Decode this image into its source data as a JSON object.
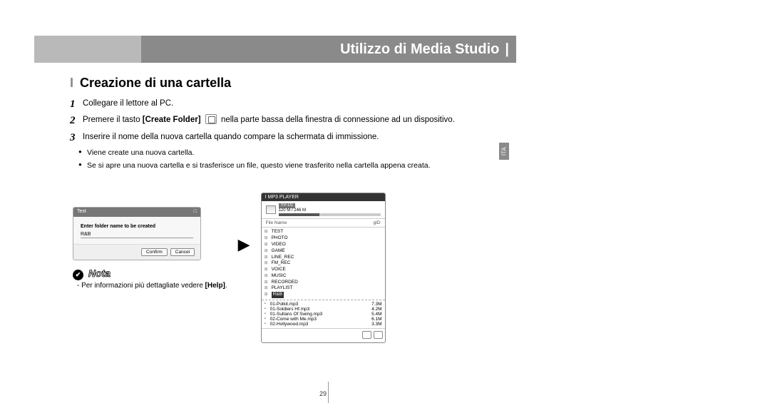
{
  "header": {
    "title": "Utilizzo di Media Studio"
  },
  "section": {
    "heading": "Creazione di una cartella",
    "bar": "I"
  },
  "steps": {
    "s1": {
      "num": "1",
      "text": "Collegare il lettore al PC."
    },
    "s2": {
      "num": "2",
      "pre": "Premere il tasto ",
      "bold": "[Create Folder]",
      "post": " nella parte bassa della finestra di connessione ad un dispositivo."
    },
    "s3": {
      "num": "3",
      "text": "Inserire il nome della nuova cartella quando compare la schermata di immissione."
    }
  },
  "bullets": {
    "b1": "Viene create una nuova cartella.",
    "b2": "Se si apre una nuova cartella e si trasferisce un file, questo viene trasferito nella cartella appena creata."
  },
  "dialog": {
    "title": "Text",
    "label": "Enter folder name to be created",
    "value": "R&B",
    "confirm": "Confirm",
    "cancel": "Cancel"
  },
  "player": {
    "title": "I MP3 PLAYER",
    "model": "YP-U1",
    "capacity": "120 M / 246 M",
    "col_name": "File Name",
    "col_id": "gID",
    "tree": [
      "TEST",
      "PHOTO",
      "VIDEO",
      "GAME",
      "LINE_REC",
      "FM_REC",
      "VOICE",
      "MUSIC",
      "RECORDED",
      "PLAYLIST",
      "R&B"
    ],
    "files": [
      {
        "name": "01-Polkit.mp3",
        "size": "7.3M"
      },
      {
        "name": "01-Soldiers Hf.mp3",
        "size": "4.2M"
      },
      {
        "name": "01-Sultans Of Swing.mp3",
        "size": "5.4M"
      },
      {
        "name": "02-Come with Me.mp3",
        "size": "6.1M"
      },
      {
        "name": "02-Hollywood.mp3",
        "size": "3.3M"
      }
    ]
  },
  "nota": {
    "label": "Nota",
    "text_pre": "- Per informazioni più dettagliate vedere ",
    "text_bold": "[Help]",
    "text_post": "."
  },
  "side_tab": "ITA",
  "page_number": "29"
}
